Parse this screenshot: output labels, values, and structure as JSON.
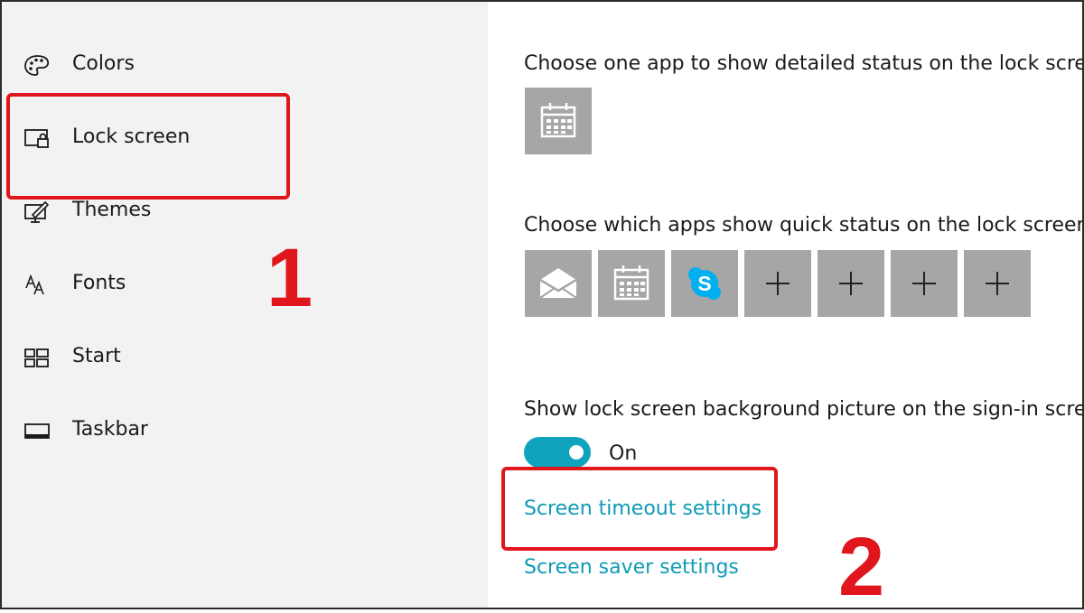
{
  "sidebar": {
    "items": [
      {
        "label": "Colors",
        "icon": "palette-icon"
      },
      {
        "label": "Lock screen",
        "icon": "lock-screen-icon"
      },
      {
        "label": "Themes",
        "icon": "themes-icon"
      },
      {
        "label": "Fonts",
        "icon": "fonts-icon"
      },
      {
        "label": "Start",
        "icon": "start-icon"
      },
      {
        "label": "Taskbar",
        "icon": "taskbar-icon"
      }
    ]
  },
  "main": {
    "detailed_status_heading": "Choose one app to show detailed status on the lock screen",
    "detailed_status_apps": [
      {
        "icon": "calendar-icon"
      }
    ],
    "quick_status_heading": "Choose which apps show quick status on the lock screen",
    "quick_status_apps": [
      {
        "icon": "mail-icon"
      },
      {
        "icon": "calendar-icon"
      },
      {
        "icon": "skype-icon"
      },
      {
        "icon": "plus-icon"
      },
      {
        "icon": "plus-icon"
      },
      {
        "icon": "plus-icon"
      },
      {
        "icon": "plus-icon"
      }
    ],
    "signin_background_heading": "Show lock screen background picture on the sign-in screen",
    "signin_background_toggle": {
      "state": "On",
      "enabled": true
    },
    "screen_timeout_link": "Screen timeout settings",
    "screen_saver_link": "Screen saver settings"
  },
  "annotations": {
    "step1": "1",
    "step2": "2",
    "highlight_color": "#e0161c"
  },
  "colors": {
    "accent": "#0e9bb6",
    "toggle_on": "#10a3bd",
    "tile": "#a6a6a6",
    "sidebar_bg": "#f2f2f2"
  }
}
